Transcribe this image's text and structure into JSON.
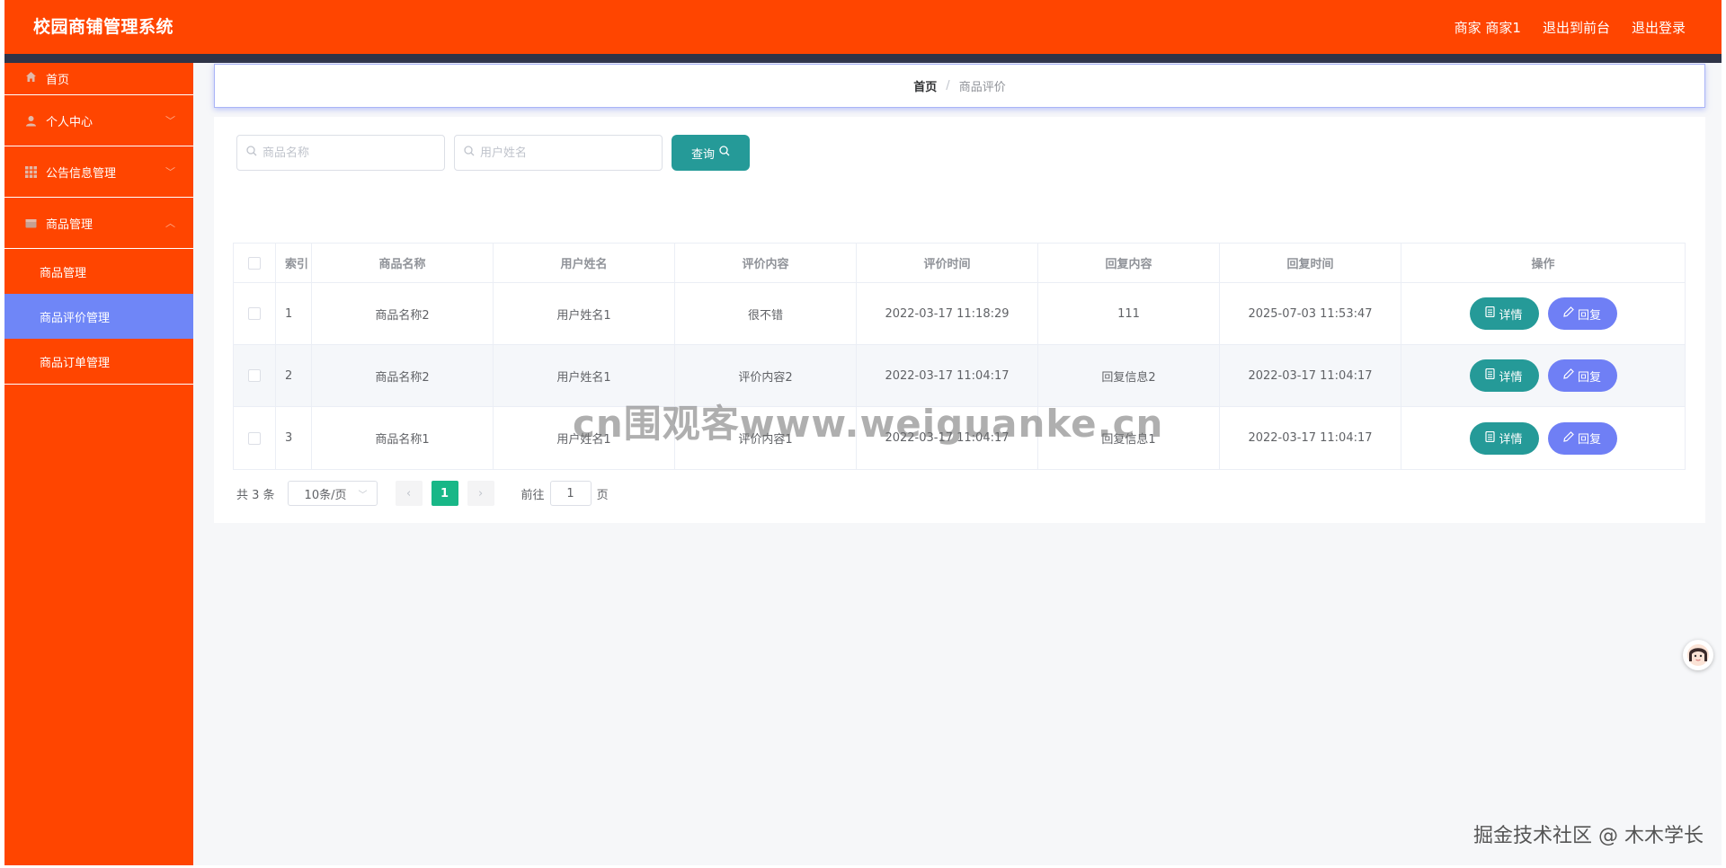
{
  "header": {
    "title": "校园商铺管理系统",
    "user": "商家 商家1",
    "to_front": "退出到前台",
    "logout": "退出登录"
  },
  "sidebar": {
    "home": "首页",
    "personal": "个人中心",
    "notice": "公告信息管理",
    "goods": "商品管理",
    "sub_items": [
      "商品管理",
      "商品评价管理",
      "商品订单管理"
    ]
  },
  "breadcrumb": {
    "home": "首页",
    "separator": "/",
    "current": "商品评价"
  },
  "search": {
    "goods_placeholder": "商品名称",
    "user_placeholder": "用户姓名",
    "button": "查询"
  },
  "table": {
    "headers": [
      "索引",
      "商品名称",
      "用户姓名",
      "评价内容",
      "评价时间",
      "回复内容",
      "回复时间",
      "操作"
    ],
    "rows": [
      [
        "1",
        "商品名称2",
        "用户姓名1",
        "很不错",
        "2022-03-17 11:18:29",
        "111",
        "2025-07-03 11:53:47"
      ],
      [
        "2",
        "商品名称2",
        "用户姓名1",
        "评价内容2",
        "2022-03-17 11:04:17",
        "回复信息2",
        "2022-03-17 11:04:17"
      ],
      [
        "3",
        "商品名称1",
        "用户姓名1",
        "评价内容1",
        "2022-03-17 11:04:17",
        "回复信息1",
        "2022-03-17 11:04:17"
      ]
    ],
    "detail_label": "详情",
    "reply_label": "回复"
  },
  "pagination": {
    "total": "共 3 条",
    "page_size": "10条/页",
    "current_page": "1",
    "goto_label": "前往",
    "goto_value": "1",
    "page_unit": "页"
  },
  "overlays": {
    "watermark": "cn围观客www.weiguanke.cn",
    "credit": "掘金技术社区 @ 木木学长"
  },
  "colors": {
    "primary": "#ff4500",
    "active_menu": "#6f86f7",
    "teal_button": "#259a98",
    "reply_button": "#6f7ff5",
    "current_page": "#18b787"
  }
}
